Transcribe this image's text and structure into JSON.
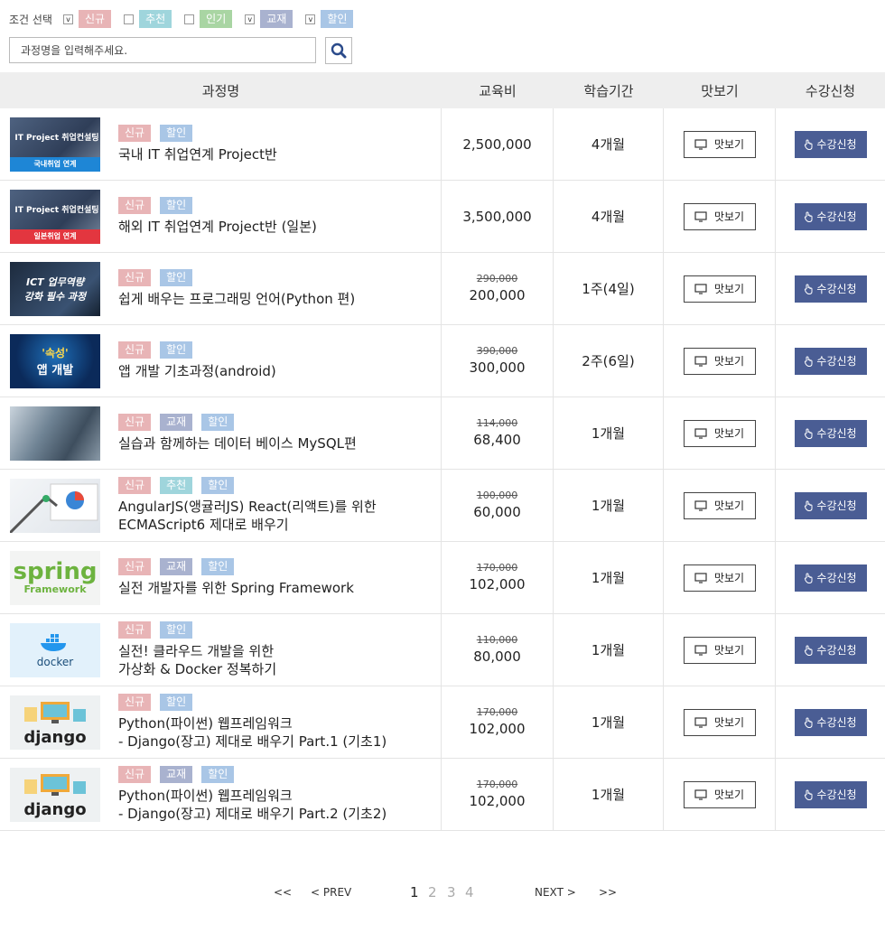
{
  "filters": {
    "label": "조건 선택",
    "items": [
      {
        "checked": "v",
        "tag": "신규",
        "color": "#e8b4b6"
      },
      {
        "checked": "",
        "tag": "추천",
        "color": "#9fd5dc"
      },
      {
        "checked": "",
        "tag": "인기",
        "color": "#a9d5a3"
      },
      {
        "checked": "v",
        "tag": "교재",
        "color": "#a9b2cf"
      },
      {
        "checked": "v",
        "tag": "할인",
        "color": "#a9c6e6"
      }
    ]
  },
  "search": {
    "placeholder": "과정명을 입력해주세요.",
    "icon": "search-icon"
  },
  "table": {
    "headers": [
      "과정명",
      "교육비",
      "학습기간",
      "맛보기",
      "수강신청"
    ],
    "preview_label": "맛보기",
    "enroll_label": "수강신청",
    "rows": [
      {
        "thumb_lines": [
          "IT Project 취업컨설팅",
          "국내취업 연계"
        ],
        "thumb_style": "it-blue",
        "tags": [
          "신규",
          "할인"
        ],
        "title_lines": [
          "국내 IT 취업연계 Project반"
        ],
        "orig": "",
        "price": "2,500,000",
        "period": "4개월"
      },
      {
        "thumb_lines": [
          "IT Project 취업컨설팅",
          "일본취업 연계"
        ],
        "thumb_style": "it-red",
        "tags": [
          "신규",
          "할인"
        ],
        "title_lines": [
          "해외 IT 취업연계 Project반 (일본)"
        ],
        "orig": "",
        "price": "3,500,000",
        "period": "4개월"
      },
      {
        "thumb_lines": [
          "ICT 업무역량",
          "강화 필수 과정"
        ],
        "thumb_style": "dark",
        "tags": [
          "신규",
          "할인"
        ],
        "title_lines": [
          "쉽게 배우는 프로그래밍 언어(Python 편)"
        ],
        "orig": "290,000",
        "price": "200,000",
        "period": "1주(4일)"
      },
      {
        "thumb_lines": [
          "'속성'",
          "앱 개발"
        ],
        "thumb_style": "navy",
        "tags": [
          "신규",
          "할인"
        ],
        "title_lines": [
          "앱 개발 기초과정(android)"
        ],
        "orig": "390,000",
        "price": "300,000",
        "period": "2주(6일)"
      },
      {
        "thumb_lines": [],
        "thumb_style": "photo",
        "tags": [
          "신규",
          "교재",
          "할인"
        ],
        "title_lines": [
          "실습과 함께하는 데이터 베이스 MySQL편"
        ],
        "orig": "114,000",
        "price": "68,400",
        "period": "1개월"
      },
      {
        "thumb_lines": [],
        "thumb_style": "chart",
        "tags": [
          "신규",
          "추천",
          "할인"
        ],
        "title_lines": [
          "AngularJS(앵귤러JS) React(리액트)를 위한",
          "ECMAScript6 제대로 배우기"
        ],
        "orig": "100,000",
        "price": "60,000",
        "period": "1개월"
      },
      {
        "thumb_lines": [
          "spring",
          "Framework"
        ],
        "thumb_style": "spring",
        "tags": [
          "신규",
          "교재",
          "할인"
        ],
        "title_lines": [
          "실전 개발자를 위한 Spring Framework"
        ],
        "orig": "170,000",
        "price": "102,000",
        "period": "1개월"
      },
      {
        "thumb_lines": [
          "docker"
        ],
        "thumb_style": "docker",
        "tags": [
          "신규",
          "할인"
        ],
        "title_lines": [
          "실전! 클라우드 개발을 위한",
          "가상화 & Docker 정복하기"
        ],
        "orig": "110,000",
        "price": "80,000",
        "period": "1개월"
      },
      {
        "thumb_lines": [
          "django"
        ],
        "thumb_style": "django",
        "tags": [
          "신규",
          "할인"
        ],
        "title_lines": [
          "Python(파이썬) 웹프레임워크",
          "- Django(장고) 제대로 배우기 Part.1 (기초1)"
        ],
        "orig": "170,000",
        "price": "102,000",
        "period": "1개월"
      },
      {
        "thumb_lines": [
          "django"
        ],
        "thumb_style": "django",
        "tags": [
          "신규",
          "교재",
          "할인"
        ],
        "title_lines": [
          "Python(파이썬) 웹프레임워크",
          "- Django(장고) 제대로 배우기 Part.2 (기초2)"
        ],
        "orig": "170,000",
        "price": "102,000",
        "period": "1개월"
      }
    ]
  },
  "pagination": {
    "first": "<<",
    "prev": "< PREV",
    "pages": [
      "1",
      "2",
      "3",
      "4"
    ],
    "current": "1",
    "next": "NEXT >",
    "last": ">>"
  },
  "colors": {
    "enroll_button": "#4a5d94",
    "header_bg": "#eeeeee",
    "search_icon": "#2a4a8a"
  }
}
